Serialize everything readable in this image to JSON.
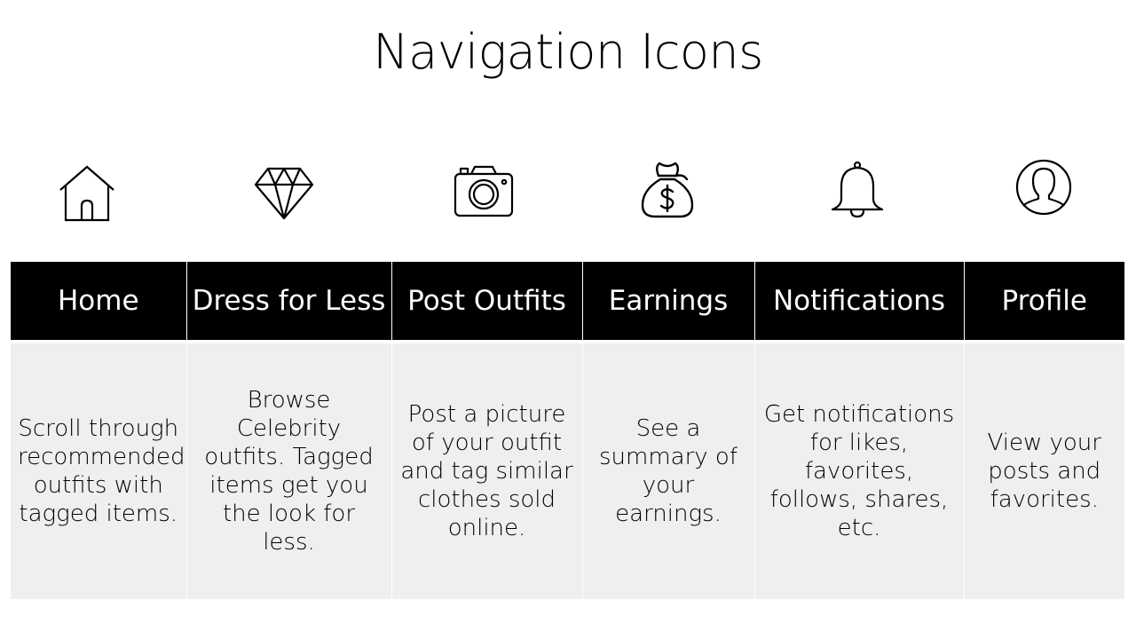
{
  "title": "Navigation Icons",
  "icons": [
    {
      "name": "home-icon"
    },
    {
      "name": "diamond-icon"
    },
    {
      "name": "camera-icon"
    },
    {
      "name": "money-bag-icon"
    },
    {
      "name": "bell-icon"
    },
    {
      "name": "profile-icon"
    }
  ],
  "columns": [
    {
      "header": "Home",
      "description": "Scroll through recommended outfits with tagged items."
    },
    {
      "header": "Dress for Less",
      "description": "Browse Celebrity outfits. Tagged items get you the look for less."
    },
    {
      "header": "Post Outfits",
      "description": "Post a picture of your outfit and tag similar clothes sold online."
    },
    {
      "header": "Earnings",
      "description": "See a summary of your earnings."
    },
    {
      "header": "Notifications",
      "description": "Get notifications for likes, favorites, follows, shares, etc."
    },
    {
      "header": "Profile",
      "description": "View your posts and favorites."
    }
  ],
  "colors": {
    "header_background": "#000000",
    "header_text": "#ffffff",
    "cell_background": "#efefef",
    "text": "#000000"
  }
}
